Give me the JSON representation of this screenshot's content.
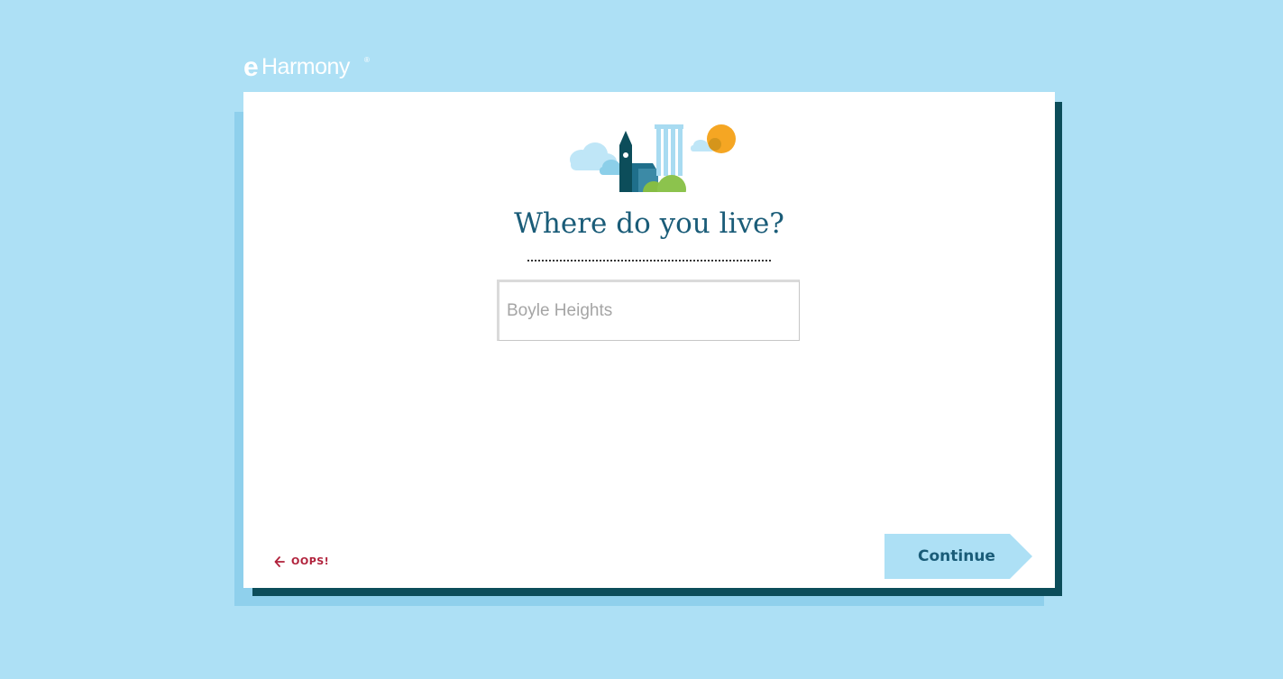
{
  "brand": {
    "logo_e": "e",
    "logo_text": "Harmony",
    "logo_mark": "®"
  },
  "question": {
    "heading": "Where do you live?"
  },
  "location_field": {
    "placeholder": "Boyle Heights",
    "value": ""
  },
  "nav": {
    "back_label": "OOPS!",
    "back_icon": "arrow-left-icon",
    "continue_label": "Continue"
  },
  "colors": {
    "background": "#ade0f5",
    "card": "#ffffff",
    "card_shadow_dark": "#0c4d5a",
    "heading": "#1a5c78",
    "back_link": "#b0203a",
    "continue_button": "#ade0f5"
  }
}
